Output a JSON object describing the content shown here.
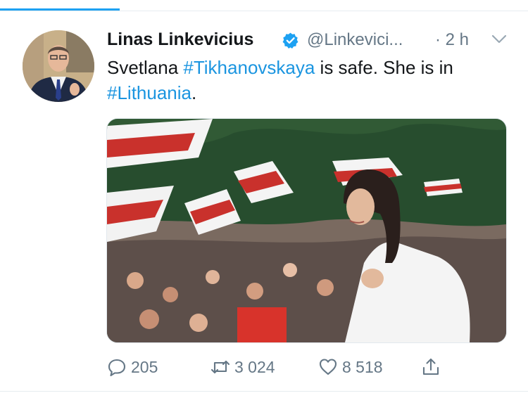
{
  "tweet": {
    "author_name": "Linas Linkevicius",
    "handle": "@Linkevici...",
    "time": "· 2 h",
    "text_parts": [
      {
        "text": "Svetlana ",
        "tag": false
      },
      {
        "text": "#Tikhanovskaya",
        "tag": true
      },
      {
        "text": " is safe. She is in ",
        "tag": false
      },
      {
        "text": "#Lithuania",
        "tag": true
      },
      {
        "text": ".",
        "tag": false
      }
    ],
    "replies": "205",
    "retweets": "3 024",
    "likes": "8 518"
  },
  "icons": {
    "verified": "verified-badge-icon",
    "more": "chevron-down-icon",
    "reply": "reply-icon",
    "retweet": "retweet-icon",
    "like": "heart-icon",
    "share": "share-icon"
  },
  "colors": {
    "accent": "#1da1f2",
    "hashtag": "#1b95e0",
    "secondary_text": "#657786",
    "divider": "#e6ecf0"
  }
}
